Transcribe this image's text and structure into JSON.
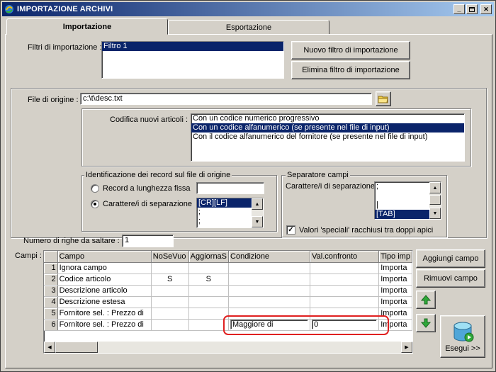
{
  "window": {
    "title": "IMPORTAZIONE ARCHIVI"
  },
  "tabs": [
    {
      "label": "Importazione",
      "active": true
    },
    {
      "label": "Esportazione",
      "active": false
    }
  ],
  "filters": {
    "label": "Filtri di importazione :",
    "items": [
      "Filtro 1"
    ],
    "new_button": "Nuovo filtro di importazione",
    "delete_button": "Elimina filtro di importazione"
  },
  "source": {
    "file_label": "File di origine :",
    "file_value": "c:\\t\\desc.txt",
    "codifica_label": "Codifica nuovi articoli :",
    "codifica_options": [
      "Con un codice numerico progressivo",
      "Con un codice alfanumerico (se presente nel file di input)",
      "Con il codice alfanumerico del fornitore (se presente nel file di input)"
    ],
    "codifica_selected": 1
  },
  "record_id": {
    "title": "Identificazione dei record sul file di origine",
    "fixed_label": "Record a lunghezza fissa",
    "sep_label": "Carattere/i di separazione",
    "sep_items": [
      "[CR][LF]",
      ";",
      ";"
    ],
    "selected": "sep"
  },
  "field_sep": {
    "title": "Separatore campi",
    "label": "Carattere/i di separazione",
    "items": [
      ";",
      "",
      "|",
      "[TAB]"
    ],
    "selected_index": 3,
    "quoted_label": "Valori 'speciali' racchiusi tra doppi apici",
    "quoted_checked": true
  },
  "skip_rows": {
    "label": "Numero di righe da saltare :",
    "value": "1"
  },
  "campi": {
    "label": "Campi :",
    "columns": [
      "Campo",
      "NoSeVuo",
      "AggiornaS",
      "Condizione",
      "Val.confronto",
      "Tipo imp"
    ],
    "rows": [
      {
        "n": "1",
        "campo": "Ignora campo",
        "nosevuo": "",
        "aggiorna": "",
        "condizione": "",
        "val": "",
        "tipo": "Importa"
      },
      {
        "n": "2",
        "campo": "Codice articolo",
        "nosevuo": "S",
        "aggiorna": "S",
        "condizione": "",
        "val": "",
        "tipo": "Importa"
      },
      {
        "n": "3",
        "campo": "Descrizione articolo",
        "nosevuo": "",
        "aggiorna": "",
        "condizione": "",
        "val": "",
        "tipo": "Importa"
      },
      {
        "n": "4",
        "campo": "Descrizione estesa",
        "nosevuo": "",
        "aggiorna": "",
        "condizione": "",
        "val": "",
        "tipo": "Importa"
      },
      {
        "n": "5",
        "campo": "Fornitore sel. : Prezzo di",
        "nosevuo": "",
        "aggiorna": "",
        "condizione": "",
        "val": "",
        "tipo": "Importa"
      },
      {
        "n": "6",
        "campo": "Fornitore sel. : Prezzo di",
        "nosevuo": "",
        "aggiorna": "",
        "condizione": "Maggiore di",
        "val": "0",
        "tipo": "Importa"
      }
    ],
    "add_button": "Aggiungi campo",
    "remove_button": "Rimuovi campo",
    "run_button": "Esegui >>"
  },
  "colors": {
    "selection": "#0a246a",
    "highlight_ring": "#e02020",
    "arrow_green": "#2fa83a"
  },
  "icons": [
    "app-icon",
    "folder-icon",
    "arrow-up-icon",
    "arrow-down-icon",
    "database-run-icon"
  ]
}
